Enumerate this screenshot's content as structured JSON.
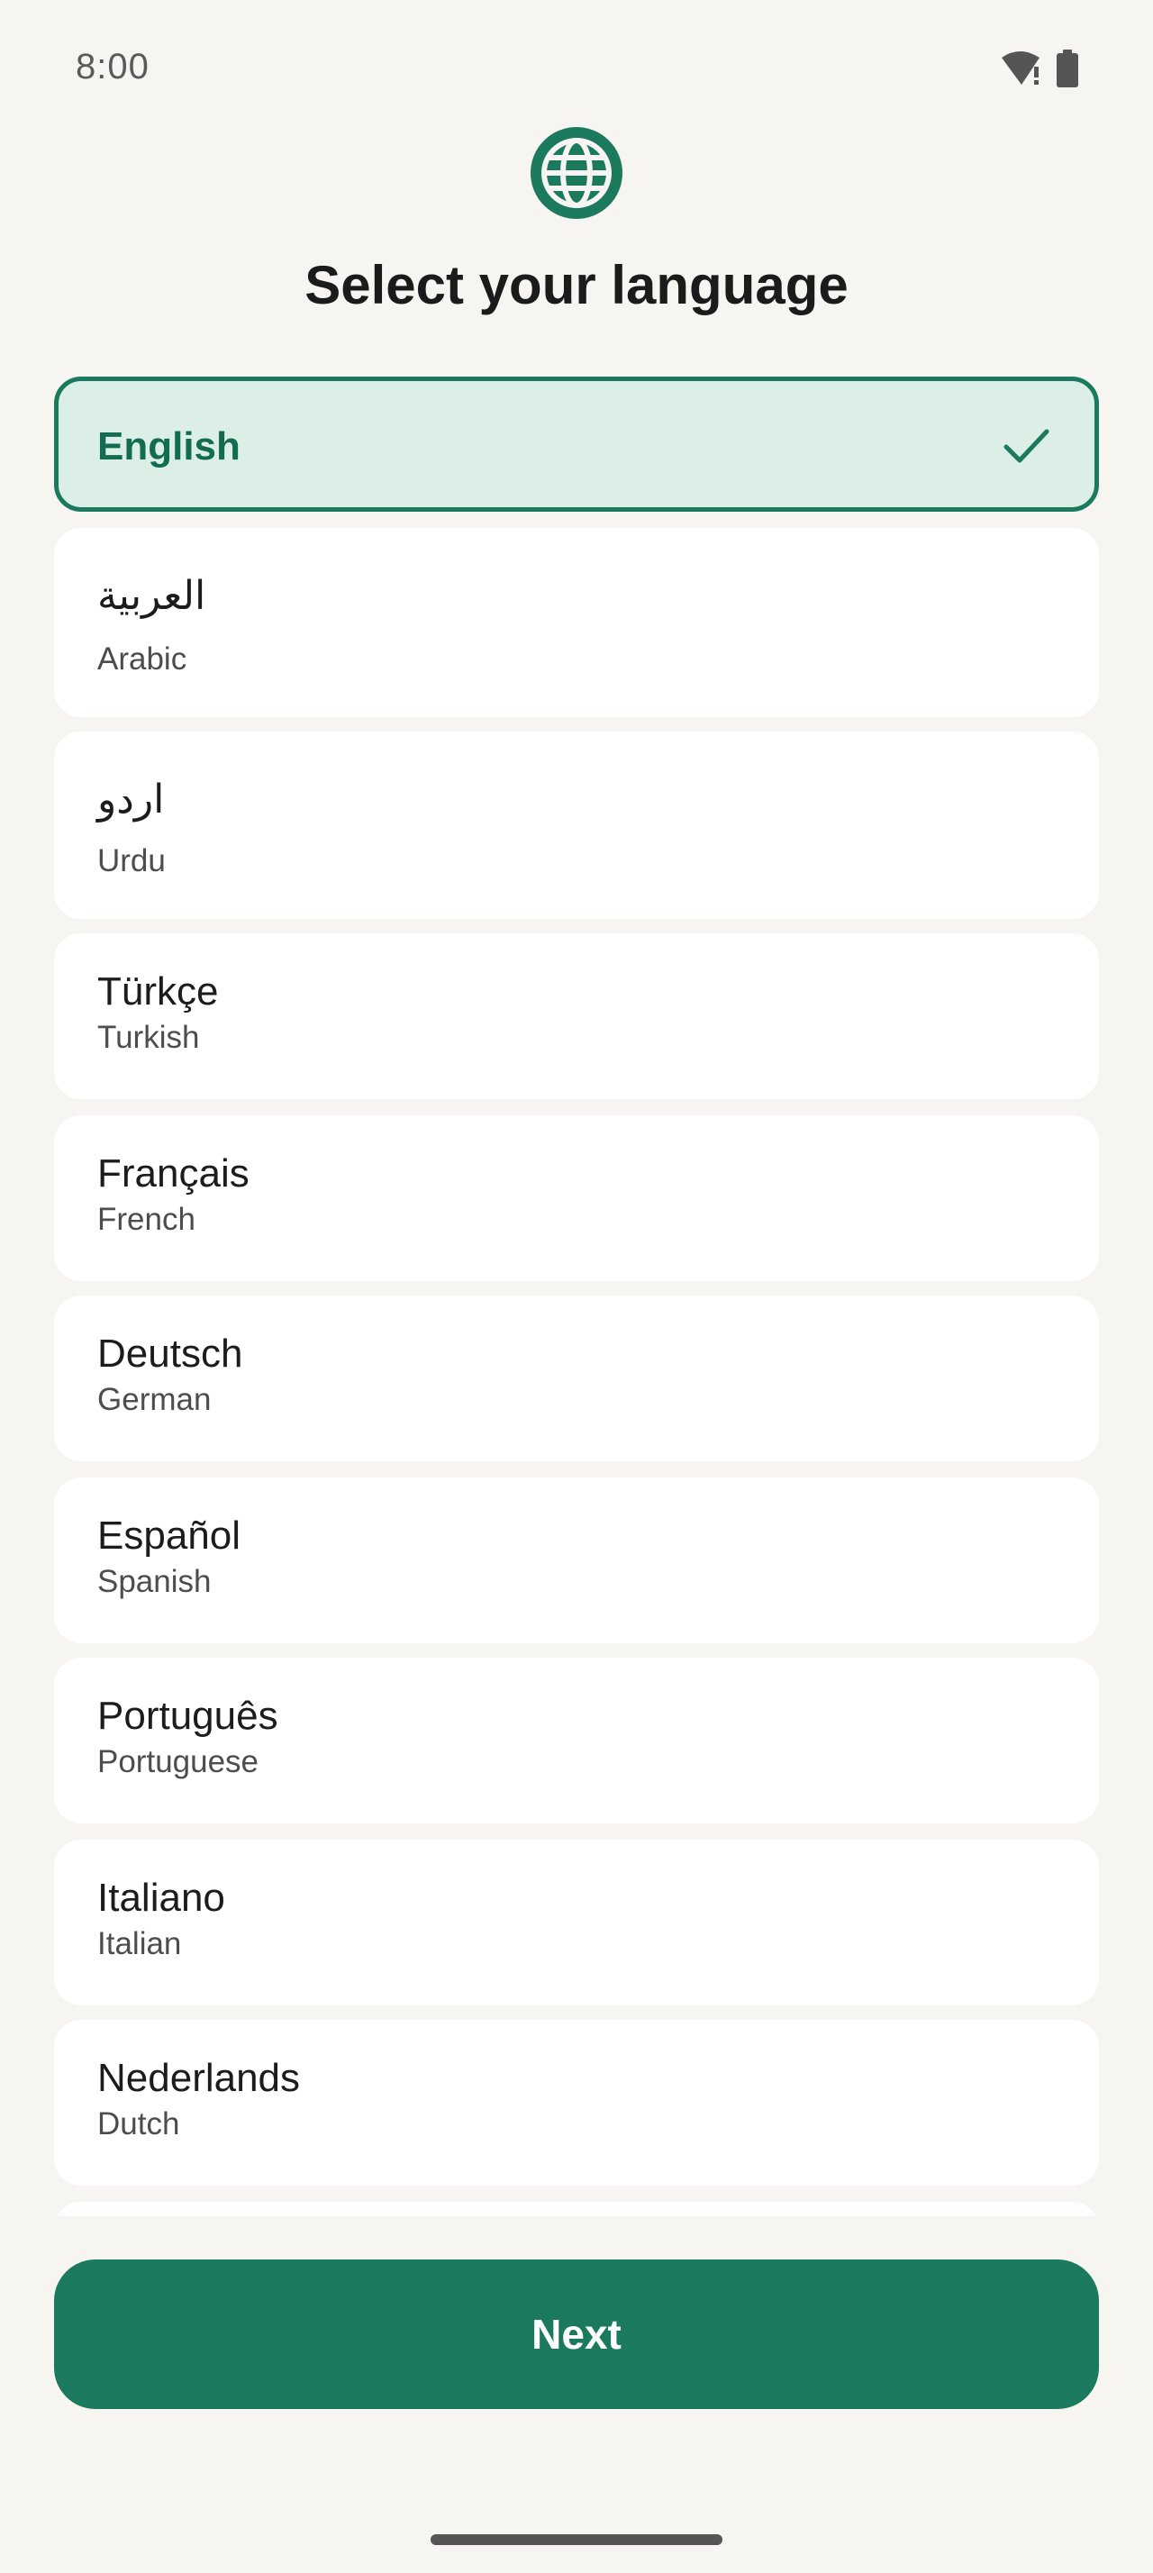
{
  "status_bar": {
    "time": "8:00",
    "icons": [
      "wifi-alert-icon",
      "battery-icon"
    ]
  },
  "header": {
    "icon": "globe-icon",
    "title": "Select your language"
  },
  "languages": [
    {
      "native": "English",
      "english": "",
      "selected": true
    },
    {
      "native": "العربية",
      "english": "Arabic",
      "selected": false
    },
    {
      "native": "اردو",
      "english": "Urdu",
      "selected": false
    },
    {
      "native": "Türkçe",
      "english": "Turkish",
      "selected": false
    },
    {
      "native": "Français",
      "english": "French",
      "selected": false
    },
    {
      "native": "Deutsch",
      "english": "German",
      "selected": false
    },
    {
      "native": "Español",
      "english": "Spanish",
      "selected": false
    },
    {
      "native": "Português",
      "english": "Portuguese",
      "selected": false
    },
    {
      "native": "Italiano",
      "english": "Italian",
      "selected": false
    },
    {
      "native": "Nederlands",
      "english": "Dutch",
      "selected": false
    }
  ],
  "footer": {
    "next_label": "Next"
  },
  "colors": {
    "accent": "#1b7a5e",
    "selected_background": "#dcefe7",
    "page_background": "#f6f5f2",
    "card_background": "#ffffff"
  }
}
